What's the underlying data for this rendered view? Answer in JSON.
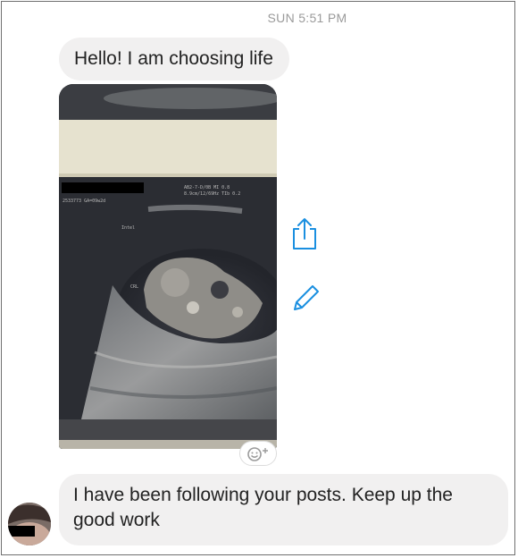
{
  "conversation": {
    "timestamp": "SUN 5:51 PM",
    "messages": [
      {
        "text": "Hello! I am choosing life"
      },
      {
        "text": "I have been following your posts. Keep up the good work"
      }
    ]
  },
  "icons": {
    "share": "share-icon",
    "edit": "pencil-icon",
    "reaction": "add-reaction-icon"
  },
  "colors": {
    "accent": "#1a8fe0",
    "bubble_bg": "#f1f0f0",
    "timestamp": "#9a9a9a"
  }
}
